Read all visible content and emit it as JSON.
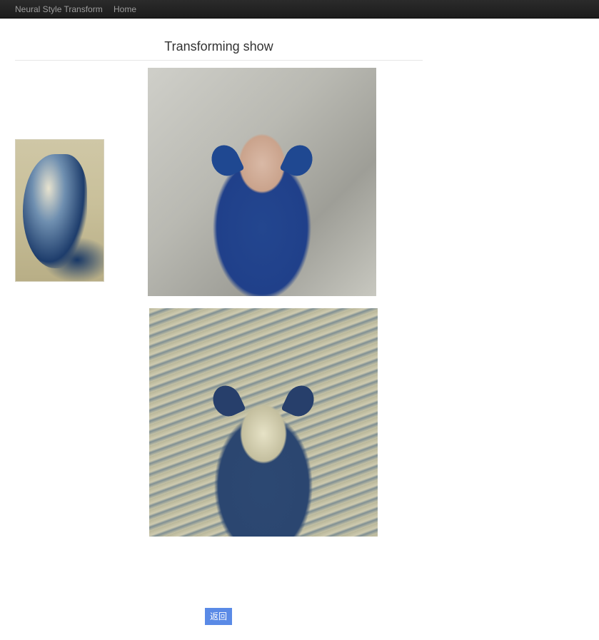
{
  "navbar": {
    "brand": "Neural Style Transform",
    "home": "Home"
  },
  "page": {
    "title": "Transforming show"
  },
  "images": {
    "style": "style-painting-image",
    "content": "content-photo-image",
    "result": "transformed-result-image"
  },
  "actions": {
    "back_label": "返回"
  },
  "colors": {
    "navbar_bg": "#222222",
    "nav_text": "#9d9d9d",
    "button_bg": "#5a8ae6"
  }
}
